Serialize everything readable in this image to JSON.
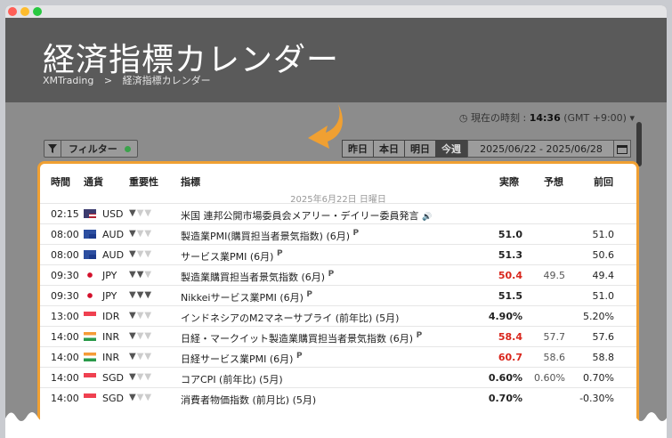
{
  "page": {
    "title": "経済指標カレンダー",
    "breadcrumb": [
      "XMTrading",
      "経済指標カレンダー"
    ]
  },
  "timezone": {
    "label": "現在の時刻 :",
    "time": "14:36",
    "zone": "(GMT +9:00)"
  },
  "toolbar": {
    "filter_label": "フィルター",
    "days": [
      "昨日",
      "本日",
      "明日",
      "今週"
    ],
    "range": "2025/06/22 - 2025/06/28"
  },
  "table": {
    "headers": {
      "time": "時間",
      "currency": "通貨",
      "importance": "重要性",
      "indicator": "指標",
      "actual": "実際",
      "forecast": "予想",
      "previous": "前回"
    },
    "date": "2025年6月22日 日曜日",
    "rows": [
      {
        "time": "02:15",
        "currency": "USD",
        "indicator": "米国 連邦公開市場委員会メアリー・デイリー委員発言",
        "actual": "",
        "forecast": "",
        "previous": "",
        "speech": "🔊",
        "prelim": ""
      },
      {
        "time": "08:00",
        "currency": "AUD",
        "indicator": "製造業PMI(購買担当者景気指数) (6月)",
        "actual": "51.0",
        "forecast": "",
        "previous": "51.0",
        "prelim": "P"
      },
      {
        "time": "08:00",
        "currency": "AUD",
        "indicator": "サービス業PMI (6月)",
        "actual": "51.3",
        "forecast": "",
        "previous": "50.6",
        "prelim": "P"
      },
      {
        "time": "09:30",
        "currency": "JPY",
        "indicator": "製造業購買担当者景気指数 (6月)",
        "actual": "50.4",
        "forecast": "49.5",
        "previous": "49.4",
        "prelim": "P"
      },
      {
        "time": "09:30",
        "currency": "JPY",
        "indicator": "Nikkeiサービス業PMI (6月)",
        "actual": "51.5",
        "forecast": "",
        "previous": "51.0",
        "prelim": "P"
      },
      {
        "time": "13:00",
        "currency": "IDR",
        "indicator": "インドネシアのM2マネーサプライ (前年比) (5月)",
        "actual": "4.90%",
        "forecast": "",
        "previous": "5.20%",
        "prelim": ""
      },
      {
        "time": "14:00",
        "currency": "INR",
        "indicator": "日経・マークイット製造業購買担当者景気指数 (6月)",
        "actual": "58.4",
        "forecast": "57.7",
        "previous": "57.6",
        "prelim": "P"
      },
      {
        "time": "14:00",
        "currency": "INR",
        "indicator": "日経サービス業PMI (6月)",
        "actual": "60.7",
        "forecast": "58.6",
        "previous": "58.8",
        "prelim": "P"
      },
      {
        "time": "14:00",
        "currency": "SGD",
        "indicator": "コアCPI (前年比) (5月)",
        "actual": "0.60%",
        "forecast": "0.60%",
        "previous": "0.70%",
        "prelim": ""
      },
      {
        "time": "14:00",
        "currency": "SGD",
        "indicator": "消費者物価指数 (前月比) (5月)",
        "actual": "0.70%",
        "forecast": "",
        "previous": "-0.30%",
        "prelim": ""
      }
    ]
  },
  "colors": {
    "accent": "#f0a032",
    "actual_red": "#d9261c"
  }
}
